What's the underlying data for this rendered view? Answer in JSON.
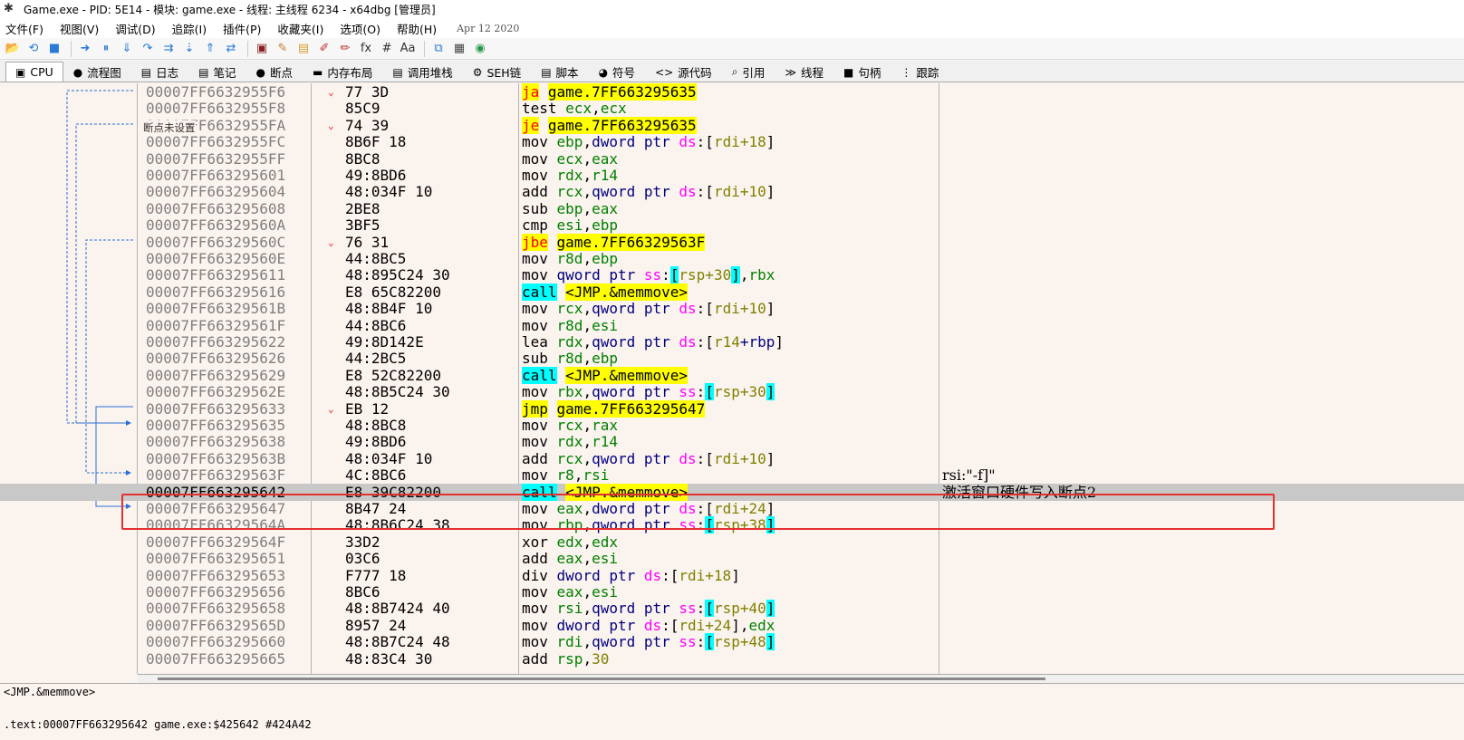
{
  "window": {
    "title": "Game.exe - PID: 5E14 - 模块: game.exe - 线程: 主线程 6234 - x64dbg [管理员]"
  },
  "menu": {
    "items": [
      "文件(F)",
      "视图(V)",
      "调试(D)",
      "追踪(I)",
      "插件(P)",
      "收藏夹(I)",
      "选项(O)",
      "帮助(H)"
    ],
    "build_date": "Apr 12 2020"
  },
  "toolbar": {
    "icons": [
      "open-icon",
      "restart-icon",
      "stop-icon",
      "run-icon",
      "pause-icon",
      "step-into-icon",
      "step-over-icon",
      "trace-into-icon",
      "trace-over-icon",
      "execute-till-return-icon",
      "run-to-user-code-icon",
      "patch-icon",
      "comment-icon",
      "label-icon",
      "bookmark-icon",
      "function-icon",
      "hash-icon",
      "font-icon",
      "memory-map-icon",
      "calculator-icon",
      "help-icon"
    ],
    "glyphs": [
      "📂",
      "⟲",
      "■",
      "➜",
      "⏸",
      "⇓",
      "↷",
      "⇉",
      "⇣",
      "⇑",
      "⇄",
      "▣",
      "✎",
      "▤",
      "✐",
      "✏",
      "fx",
      "#",
      "Aa",
      "⧉",
      "▦",
      "◉"
    ]
  },
  "tabs": [
    {
      "label": "CPU",
      "icon": "▣",
      "icon_name": "cpu-icon",
      "active": true
    },
    {
      "label": "流程图",
      "icon": "●",
      "icon_name": "graph-icon"
    },
    {
      "label": "日志",
      "icon": "▤",
      "icon_name": "log-icon"
    },
    {
      "label": "笔记",
      "icon": "▤",
      "icon_name": "notes-icon"
    },
    {
      "label": "断点",
      "icon": "●",
      "icon_name": "breakpoint-icon"
    },
    {
      "label": "内存布局",
      "icon": "▬",
      "icon_name": "memory-map-icon"
    },
    {
      "label": "调用堆栈",
      "icon": "▤",
      "icon_name": "call-stack-icon"
    },
    {
      "label": "SEH链",
      "icon": "⚙",
      "icon_name": "seh-icon"
    },
    {
      "label": "脚本",
      "icon": "▤",
      "icon_name": "script-icon"
    },
    {
      "label": "符号",
      "icon": "◕",
      "icon_name": "symbols-icon"
    },
    {
      "label": "源代码",
      "icon": "<>",
      "icon_name": "source-icon"
    },
    {
      "label": "引用",
      "icon": "⌕",
      "icon_name": "references-icon"
    },
    {
      "label": "线程",
      "icon": "≫",
      "icon_name": "threads-icon"
    },
    {
      "label": "句柄",
      "icon": "■",
      "icon_name": "handles-icon"
    },
    {
      "label": "跟踪",
      "icon": "⋮",
      "icon_name": "trace-icon"
    }
  ],
  "disasm": {
    "breakpoint_note": "断点未设置",
    "rows": [
      {
        "addr": "00007FF6632955F6",
        "mark": "⌄",
        "bytes": "77 3D",
        "asm": [
          [
            "jmp",
            "ja"
          ],
          [
            "sp",
            " "
          ],
          [
            "jtarget",
            "game.7FF663295635"
          ]
        ]
      },
      {
        "addr": "00007FF6632955F8",
        "mark": "",
        "bytes": "85C9",
        "asm": [
          [
            "m",
            "test "
          ],
          [
            "reg",
            "ecx"
          ],
          [
            "p",
            ","
          ],
          [
            "reg",
            "ecx"
          ]
        ]
      },
      {
        "addr": "00007FF6632955FA",
        "mark": "⌄",
        "bytes": "74 39",
        "asm": [
          [
            "jmp",
            "je"
          ],
          [
            "sp",
            " "
          ],
          [
            "jtarget",
            "game.7FF663295635"
          ]
        ]
      },
      {
        "addr": "00007FF6632955FC",
        "mark": "",
        "bytes": "8B6F 18",
        "asm": [
          [
            "m",
            "mov "
          ],
          [
            "reg",
            "ebp"
          ],
          [
            "p",
            ","
          ],
          [
            "ptr",
            "dword ptr "
          ],
          [
            "seg",
            "ds"
          ],
          [
            "p",
            ":["
          ],
          [
            "num",
            "rdi+18"
          ],
          [
            "p",
            "]"
          ]
        ]
      },
      {
        "addr": "00007FF6632955FF",
        "mark": "",
        "bytes": "8BC8",
        "asm": [
          [
            "m",
            "mov "
          ],
          [
            "reg",
            "ecx"
          ],
          [
            "p",
            ","
          ],
          [
            "reg",
            "eax"
          ]
        ]
      },
      {
        "addr": "00007FF663295601",
        "mark": "",
        "bytes": "49:8BD6",
        "asm": [
          [
            "m",
            "mov "
          ],
          [
            "reg",
            "rdx"
          ],
          [
            "p",
            ","
          ],
          [
            "reg",
            "r14"
          ]
        ]
      },
      {
        "addr": "00007FF663295604",
        "mark": "",
        "bytes": "48:034F 10",
        "asm": [
          [
            "m",
            "add "
          ],
          [
            "reg",
            "rcx"
          ],
          [
            "p",
            ","
          ],
          [
            "ptr",
            "qword ptr "
          ],
          [
            "seg",
            "ds"
          ],
          [
            "p",
            ":["
          ],
          [
            "num",
            "rdi+10"
          ],
          [
            "p",
            "]"
          ]
        ]
      },
      {
        "addr": "00007FF663295608",
        "mark": "",
        "bytes": "2BE8",
        "asm": [
          [
            "m",
            "sub "
          ],
          [
            "reg",
            "ebp"
          ],
          [
            "p",
            ","
          ],
          [
            "reg",
            "eax"
          ]
        ]
      },
      {
        "addr": "00007FF66329560A",
        "mark": "",
        "bytes": "3BF5",
        "asm": [
          [
            "m",
            "cmp "
          ],
          [
            "reg",
            "esi"
          ],
          [
            "p",
            ","
          ],
          [
            "reg",
            "ebp"
          ]
        ]
      },
      {
        "addr": "00007FF66329560C",
        "mark": "⌄",
        "bytes": "76 31",
        "asm": [
          [
            "jmp",
            "jbe"
          ],
          [
            "sp",
            " "
          ],
          [
            "jtarget",
            "game.7FF66329563F"
          ]
        ]
      },
      {
        "addr": "00007FF66329560E",
        "mark": "",
        "bytes": "44:8BC5",
        "asm": [
          [
            "m",
            "mov "
          ],
          [
            "reg",
            "r8d"
          ],
          [
            "p",
            ","
          ],
          [
            "reg",
            "ebp"
          ]
        ]
      },
      {
        "addr": "00007FF663295611",
        "mark": "",
        "bytes": "48:895C24 30",
        "asm": [
          [
            "m",
            "mov "
          ],
          [
            "ptr",
            "qword ptr "
          ],
          [
            "seg",
            "ss"
          ],
          [
            "p",
            ":"
          ],
          [
            "cyan",
            "["
          ],
          [
            "num",
            "rsp+30"
          ],
          [
            "cyan",
            "]"
          ],
          [
            "p",
            ","
          ],
          [
            "reg",
            "rbx"
          ]
        ]
      },
      {
        "addr": "00007FF663295616",
        "mark": "",
        "bytes": "E8 65C82200",
        "asm": [
          [
            "call",
            "call"
          ],
          [
            "sp",
            " "
          ],
          [
            "ctarget",
            "<JMP.&memmove>"
          ]
        ]
      },
      {
        "addr": "00007FF66329561B",
        "mark": "",
        "bytes": "48:8B4F 10",
        "asm": [
          [
            "m",
            "mov "
          ],
          [
            "reg",
            "rcx"
          ],
          [
            "p",
            ","
          ],
          [
            "ptr",
            "qword ptr "
          ],
          [
            "seg",
            "ds"
          ],
          [
            "p",
            ":["
          ],
          [
            "num",
            "rdi+10"
          ],
          [
            "p",
            "]"
          ]
        ]
      },
      {
        "addr": "00007FF66329561F",
        "mark": "",
        "bytes": "44:8BC6",
        "asm": [
          [
            "m",
            "mov "
          ],
          [
            "reg",
            "r8d"
          ],
          [
            "p",
            ","
          ],
          [
            "reg",
            "esi"
          ]
        ]
      },
      {
        "addr": "00007FF663295622",
        "mark": "",
        "bytes": "49:8D142E",
        "asm": [
          [
            "m",
            "lea "
          ],
          [
            "reg",
            "rdx"
          ],
          [
            "p",
            ","
          ],
          [
            "ptr",
            "qword ptr "
          ],
          [
            "seg",
            "ds"
          ],
          [
            "p",
            ":["
          ],
          [
            "num",
            "r14"
          ],
          [
            "ptr",
            "+rbp"
          ],
          [
            "p",
            "]"
          ]
        ]
      },
      {
        "addr": "00007FF663295626",
        "mark": "",
        "bytes": "44:2BC5",
        "asm": [
          [
            "m",
            "sub "
          ],
          [
            "reg",
            "r8d"
          ],
          [
            "p",
            ","
          ],
          [
            "reg",
            "ebp"
          ]
        ]
      },
      {
        "addr": "00007FF663295629",
        "mark": "",
        "bytes": "E8 52C82200",
        "asm": [
          [
            "call",
            "call"
          ],
          [
            "sp",
            " "
          ],
          [
            "ctarget",
            "<JMP.&memmove>"
          ]
        ]
      },
      {
        "addr": "00007FF66329562E",
        "mark": "",
        "bytes": "48:8B5C24 30",
        "asm": [
          [
            "m",
            "mov "
          ],
          [
            "reg",
            "rbx"
          ],
          [
            "p",
            ","
          ],
          [
            "ptr",
            "qword ptr "
          ],
          [
            "seg",
            "ss"
          ],
          [
            "p",
            ":"
          ],
          [
            "cyan",
            "["
          ],
          [
            "num",
            "rsp+30"
          ],
          [
            "cyan",
            "]"
          ]
        ]
      },
      {
        "addr": "00007FF663295633",
        "mark": "⌄",
        "bytes": "EB 12",
        "asm": [
          [
            "jmpy",
            "jmp"
          ],
          [
            "sp",
            " "
          ],
          [
            "jtarget",
            "game.7FF663295647"
          ]
        ]
      },
      {
        "addr": "00007FF663295635",
        "mark": "",
        "bytes": "48:8BC8",
        "asm": [
          [
            "m",
            "mov "
          ],
          [
            "reg",
            "rcx"
          ],
          [
            "p",
            ","
          ],
          [
            "reg",
            "rax"
          ]
        ]
      },
      {
        "addr": "00007FF663295638",
        "mark": "",
        "bytes": "49:8BD6",
        "asm": [
          [
            "m",
            "mov "
          ],
          [
            "reg",
            "rdx"
          ],
          [
            "p",
            ","
          ],
          [
            "reg",
            "r14"
          ]
        ]
      },
      {
        "addr": "00007FF66329563B",
        "mark": "",
        "bytes": "48:034F 10",
        "asm": [
          [
            "m",
            "add "
          ],
          [
            "reg",
            "rcx"
          ],
          [
            "p",
            ","
          ],
          [
            "ptr",
            "qword ptr "
          ],
          [
            "seg",
            "ds"
          ],
          [
            "p",
            ":["
          ],
          [
            "num",
            "rdi+10"
          ],
          [
            "p",
            "]"
          ]
        ]
      },
      {
        "addr": "00007FF66329563F",
        "mark": "",
        "bytes": "4C:8BC6",
        "asm": [
          [
            "m",
            "mov "
          ],
          [
            "reg",
            "r8"
          ],
          [
            "p",
            ","
          ],
          [
            "reg",
            "rsi"
          ]
        ],
        "comment": "rsi:\"-f]\""
      },
      {
        "addr": "00007FF663295642",
        "mark": "",
        "bytes": "E8 39C82200",
        "asm": [
          [
            "call",
            "call"
          ],
          [
            "sp",
            " "
          ],
          [
            "ctarget",
            "<JMP.&memmove>"
          ]
        ],
        "comment": "激活窗口硬件写入断点2",
        "selected": true
      },
      {
        "addr": "00007FF663295647",
        "mark": "",
        "bytes": "8B47 24",
        "asm": [
          [
            "m",
            "mov "
          ],
          [
            "reg",
            "eax"
          ],
          [
            "p",
            ","
          ],
          [
            "ptr",
            "dword ptr "
          ],
          [
            "seg",
            "ds"
          ],
          [
            "p",
            ":["
          ],
          [
            "num",
            "rdi+24"
          ],
          [
            "p",
            "]"
          ]
        ]
      },
      {
        "addr": "00007FF66329564A",
        "mark": "",
        "bytes": "48:8B6C24 38",
        "asm": [
          [
            "m",
            "mov "
          ],
          [
            "reg",
            "rbp"
          ],
          [
            "p",
            ","
          ],
          [
            "ptr",
            "qword ptr "
          ],
          [
            "seg",
            "ss"
          ],
          [
            "p",
            ":"
          ],
          [
            "cyan",
            "["
          ],
          [
            "num",
            "rsp+38"
          ],
          [
            "cyan",
            "]"
          ]
        ]
      },
      {
        "addr": "00007FF66329564F",
        "mark": "",
        "bytes": "33D2",
        "asm": [
          [
            "m",
            "xor "
          ],
          [
            "reg",
            "edx"
          ],
          [
            "p",
            ","
          ],
          [
            "reg",
            "edx"
          ]
        ]
      },
      {
        "addr": "00007FF663295651",
        "mark": "",
        "bytes": "03C6",
        "asm": [
          [
            "m",
            "add "
          ],
          [
            "reg",
            "eax"
          ],
          [
            "p",
            ","
          ],
          [
            "reg",
            "esi"
          ]
        ]
      },
      {
        "addr": "00007FF663295653",
        "mark": "",
        "bytes": "F777 18",
        "asm": [
          [
            "m",
            "div "
          ],
          [
            "ptr",
            "dword ptr "
          ],
          [
            "seg",
            "ds"
          ],
          [
            "p",
            ":["
          ],
          [
            "num",
            "rdi+18"
          ],
          [
            "p",
            "]"
          ]
        ]
      },
      {
        "addr": "00007FF663295656",
        "mark": "",
        "bytes": "8BC6",
        "asm": [
          [
            "m",
            "mov "
          ],
          [
            "reg",
            "eax"
          ],
          [
            "p",
            ","
          ],
          [
            "reg",
            "esi"
          ]
        ]
      },
      {
        "addr": "00007FF663295658",
        "mark": "",
        "bytes": "48:8B7424 40",
        "asm": [
          [
            "m",
            "mov "
          ],
          [
            "reg",
            "rsi"
          ],
          [
            "p",
            ","
          ],
          [
            "ptr",
            "qword ptr "
          ],
          [
            "seg",
            "ss"
          ],
          [
            "p",
            ":"
          ],
          [
            "cyan",
            "["
          ],
          [
            "num",
            "rsp+40"
          ],
          [
            "cyan",
            "]"
          ]
        ]
      },
      {
        "addr": "00007FF66329565D",
        "mark": "",
        "bytes": "8957 24",
        "asm": [
          [
            "m",
            "mov "
          ],
          [
            "ptr",
            "dword ptr "
          ],
          [
            "seg",
            "ds"
          ],
          [
            "p",
            ":["
          ],
          [
            "num",
            "rdi+24"
          ],
          [
            "p",
            "],"
          ],
          [
            "reg",
            "edx"
          ]
        ]
      },
      {
        "addr": "00007FF663295660",
        "mark": "",
        "bytes": "48:8B7C24 48",
        "asm": [
          [
            "m",
            "mov "
          ],
          [
            "reg",
            "rdi"
          ],
          [
            "p",
            ","
          ],
          [
            "ptr",
            "qword ptr "
          ],
          [
            "seg",
            "ss"
          ],
          [
            "p",
            ":"
          ],
          [
            "cyan",
            "["
          ],
          [
            "num",
            "rsp+48"
          ],
          [
            "cyan",
            "]"
          ]
        ]
      },
      {
        "addr": "00007FF663295665",
        "mark": "",
        "bytes": "48:83C4 30",
        "asm": [
          [
            "m",
            "add "
          ],
          [
            "reg",
            "rsp"
          ],
          [
            "p",
            ","
          ],
          [
            "num",
            "30"
          ]
        ]
      }
    ]
  },
  "info": {
    "line1": "<JMP.&memmove>",
    "line2": ".text:00007FF663295642 game.exe:$425642 #424A42"
  }
}
